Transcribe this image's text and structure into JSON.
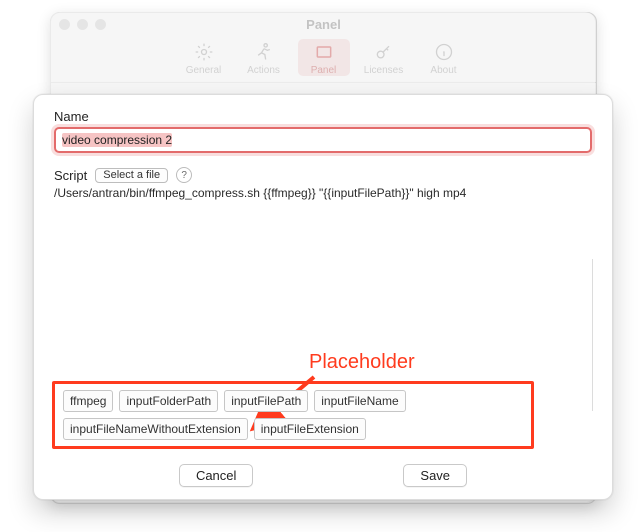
{
  "parent_window": {
    "title": "Panel",
    "tabs": [
      {
        "label": "General"
      },
      {
        "label": "Actions"
      },
      {
        "label": "Panel"
      },
      {
        "label": "Licenses"
      },
      {
        "label": "About"
      }
    ],
    "selected_tab_index": 2
  },
  "form": {
    "name_label": "Name",
    "name_value": "video compression 2",
    "script_label": "Script",
    "select_file_label": "Select a file",
    "script_path": "/Users/antran/bin/ffmpeg_compress.sh {{ffmpeg}} \"{{inputFilePath}}\" high mp4"
  },
  "placeholders": {
    "chips": [
      "ffmpeg",
      "inputFolderPath",
      "inputFilePath",
      "inputFileName",
      "inputFileNameWithoutExtension",
      "inputFileExtension"
    ]
  },
  "annotation": {
    "label": "Placeholder"
  },
  "buttons": {
    "cancel": "Cancel",
    "save": "Save"
  }
}
